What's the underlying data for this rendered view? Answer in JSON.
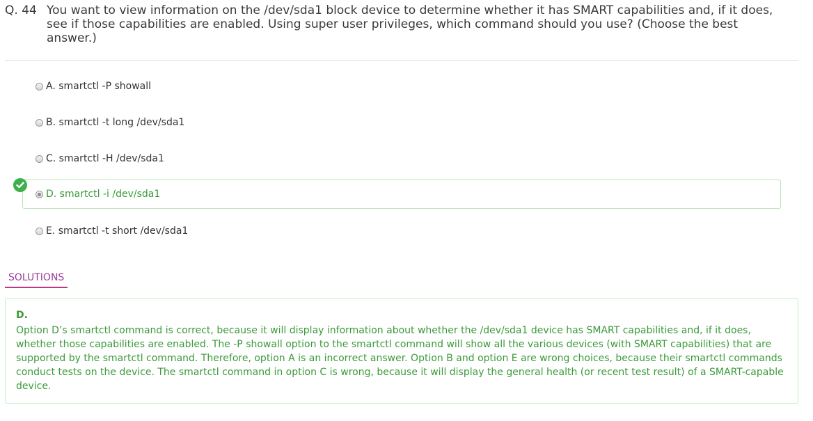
{
  "question": {
    "number": "Q. 44",
    "text": "You want to view information on the /dev/sda1 block device to determine whether it has SMART capabilities and, if it does, see if those capabilities are enabled. Using super user privileges, which command should you use? (Choose the best answer.)"
  },
  "options": [
    {
      "label": "A. smartctl -P showall"
    },
    {
      "label": "B. smartctl -t long /dev/sda1"
    },
    {
      "label": "C. smartctl -H /dev/sda1"
    },
    {
      "label": "D. smartctl -i /dev/sda1"
    },
    {
      "label": "E. smartctl -t short /dev/sda1"
    }
  ],
  "selected_option": "D",
  "correct_option": "D",
  "solutions": {
    "tab_label": "SOLUTIONS",
    "answer_letter": "D.",
    "explanation": "Option D’s smartctl command is correct, because it will display information about whether the /dev/sda1 device has SMART capabilities and, if it does, whether those capabilities are enabled. The -P showall option to the smartctl command will show all the various devices (with SMART capabilities) that are supported by the smartctl command. Therefore, option A is an incorrect answer. Option B and option E are wrong choices, because their smartctl commands conduct tests on the device. The smartctl command in option C is wrong, because it will display the general health (or recent test result) of a SMART-capable device."
  },
  "colors": {
    "correct_green": "#3a9a3a",
    "solutions_tab": "#9a3c9a",
    "tab_underline": "#c0358a"
  },
  "icons": {
    "correct_marker": "check-circle-icon"
  }
}
